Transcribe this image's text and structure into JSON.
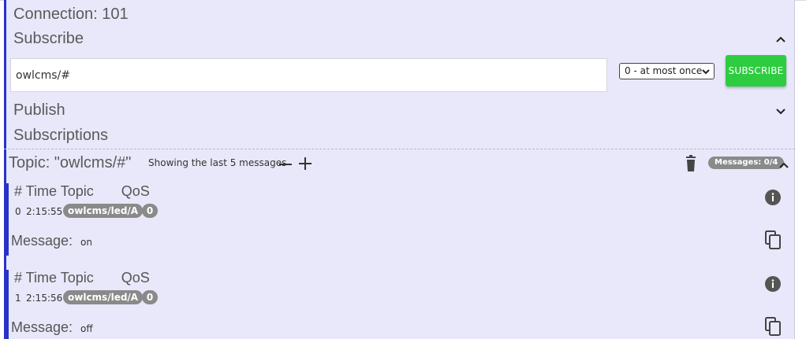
{
  "connection": {
    "title": "Connection: 101"
  },
  "subscribe": {
    "title": "Subscribe",
    "topic_value": "owlcms/#",
    "qos_selected": "0 - at most once",
    "button_label": "SUBSCRIBE",
    "button_color": "#2ecc40"
  },
  "publish": {
    "title": "Publish"
  },
  "subscriptions": {
    "title": "Subscriptions",
    "topic_title": "Topic: \"owlcms/#\"",
    "showing_text": "Showing the last 5 messages",
    "messages_badge": "Messages: 0/4",
    "messages": [
      {
        "header": "# Time Topic       QoS",
        "index": "0",
        "time": "2:15:55",
        "topic": "owlcms/led/A",
        "qos": "0",
        "message_label": "Message:",
        "message_value": "on"
      },
      {
        "header": "# Time Topic       QoS",
        "index": "1",
        "time": "2:15:56",
        "topic": "owlcms/led/A",
        "qos": "0",
        "message_label": "Message:",
        "message_value": "off"
      }
    ]
  },
  "icons": {
    "collapse": "chevron-up-icon",
    "expand": "chevron-down-icon",
    "remove": "minus-icon",
    "add": "plus-icon",
    "delete": "trash-icon",
    "info": "info-icon",
    "copy": "copy-icon"
  },
  "colors": {
    "accent_bar": "#2733c8",
    "panel_bg": "#e8e8fa",
    "badge_gray": "#8a8a8a"
  }
}
